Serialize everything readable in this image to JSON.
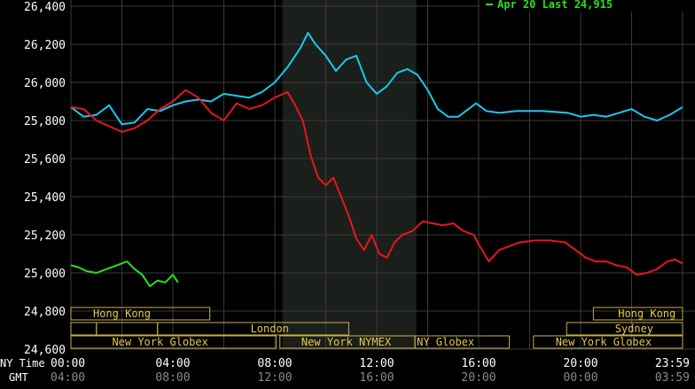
{
  "chart_data": {
    "type": "line",
    "legend_text": "Apr 20 Last 24,915",
    "legend_position": "top-right",
    "grid": true,
    "y_axis": {
      "min": 24600,
      "max": 26400,
      "ticks": [
        24600,
        24800,
        25000,
        25200,
        25400,
        25600,
        25800,
        26000,
        26200,
        26400
      ],
      "tick_labels": [
        "24,600",
        "24,800",
        "25,000",
        "25,200",
        "25,400",
        "25,600",
        "25,800",
        "26,000",
        "26,200",
        "26,400"
      ]
    },
    "x_axis": {
      "min": 0,
      "max": 24,
      "row_labels": [
        "NY Time",
        "GMT"
      ],
      "ny_ticks": [
        0,
        4,
        8,
        12,
        16,
        20,
        24
      ],
      "ny_labels": [
        "00:00",
        "04:00",
        "08:00",
        "12:00",
        "16:00",
        "20:00",
        "23:59"
      ],
      "gmt_labels": [
        "04:00",
        "08:00",
        "12:00",
        "16:00",
        "20:00",
        "00:00",
        "03:59"
      ]
    },
    "shaded_region": {
      "x_start": 8.3,
      "x_end": 13.55
    },
    "series": [
      {
        "color": "#19c8f0",
        "points": [
          [
            0,
            25870
          ],
          [
            0.5,
            25820
          ],
          [
            1,
            25830
          ],
          [
            1.5,
            25880
          ],
          [
            2,
            25780
          ],
          [
            2.5,
            25790
          ],
          [
            3,
            25860
          ],
          [
            3.5,
            25850
          ],
          [
            4,
            25880
          ],
          [
            4.5,
            25900
          ],
          [
            5,
            25910
          ],
          [
            5.5,
            25900
          ],
          [
            6,
            25940
          ],
          [
            6.5,
            25930
          ],
          [
            7,
            25920
          ],
          [
            7.5,
            25950
          ],
          [
            8,
            26000
          ],
          [
            8.5,
            26080
          ],
          [
            9,
            26180
          ],
          [
            9.3,
            26260
          ],
          [
            9.6,
            26200
          ],
          [
            10,
            26140
          ],
          [
            10.4,
            26060
          ],
          [
            10.8,
            26120
          ],
          [
            11.2,
            26140
          ],
          [
            11.6,
            26000
          ],
          [
            12,
            25940
          ],
          [
            12.4,
            25980
          ],
          [
            12.8,
            26050
          ],
          [
            13.2,
            26070
          ],
          [
            13.6,
            26040
          ],
          [
            14,
            25960
          ],
          [
            14.4,
            25860
          ],
          [
            14.8,
            25820
          ],
          [
            15.2,
            25820
          ],
          [
            15.6,
            25860
          ],
          [
            15.9,
            25890
          ],
          [
            16.3,
            25850
          ],
          [
            16.8,
            25840
          ],
          [
            17.5,
            25850
          ],
          [
            18.5,
            25850
          ],
          [
            19.5,
            25840
          ],
          [
            20,
            25820
          ],
          [
            20.5,
            25830
          ],
          [
            21,
            25820
          ],
          [
            21.5,
            25840
          ],
          [
            22,
            25860
          ],
          [
            22.5,
            25820
          ],
          [
            23,
            25800
          ],
          [
            23.5,
            25830
          ],
          [
            24,
            25870
          ]
        ]
      },
      {
        "color": "#e8161b",
        "points": [
          [
            0,
            25870
          ],
          [
            0.5,
            25860
          ],
          [
            1,
            25800
          ],
          [
            1.5,
            25770
          ],
          [
            2,
            25740
          ],
          [
            2.5,
            25760
          ],
          [
            3,
            25800
          ],
          [
            3.5,
            25860
          ],
          [
            4,
            25900
          ],
          [
            4.5,
            25960
          ],
          [
            5,
            25920
          ],
          [
            5.5,
            25840
          ],
          [
            6,
            25800
          ],
          [
            6.5,
            25890
          ],
          [
            7,
            25860
          ],
          [
            7.5,
            25880
          ],
          [
            8,
            25920
          ],
          [
            8.5,
            25950
          ],
          [
            8.8,
            25880
          ],
          [
            9.1,
            25800
          ],
          [
            9.4,
            25620
          ],
          [
            9.7,
            25500
          ],
          [
            10,
            25460
          ],
          [
            10.3,
            25500
          ],
          [
            10.6,
            25400
          ],
          [
            10.9,
            25300
          ],
          [
            11.2,
            25180
          ],
          [
            11.5,
            25120
          ],
          [
            11.8,
            25200
          ],
          [
            12.1,
            25100
          ],
          [
            12.4,
            25080
          ],
          [
            12.7,
            25160
          ],
          [
            13,
            25200
          ],
          [
            13.4,
            25220
          ],
          [
            13.8,
            25270
          ],
          [
            14.2,
            25260
          ],
          [
            14.6,
            25250
          ],
          [
            15,
            25260
          ],
          [
            15.4,
            25220
          ],
          [
            15.8,
            25200
          ],
          [
            16,
            25150
          ],
          [
            16.4,
            25060
          ],
          [
            16.8,
            25120
          ],
          [
            17.2,
            25140
          ],
          [
            17.6,
            25160
          ],
          [
            18.2,
            25170
          ],
          [
            18.8,
            25170
          ],
          [
            19.4,
            25160
          ],
          [
            19.8,
            25120
          ],
          [
            20.2,
            25080
          ],
          [
            20.6,
            25060
          ],
          [
            21,
            25060
          ],
          [
            21.4,
            25040
          ],
          [
            21.8,
            25030
          ],
          [
            22.2,
            24990
          ],
          [
            22.6,
            25000
          ],
          [
            23,
            25020
          ],
          [
            23.4,
            25060
          ],
          [
            23.7,
            25070
          ],
          [
            24,
            25050
          ]
        ]
      },
      {
        "color": "#2ae01f",
        "points": [
          [
            0,
            25040
          ],
          [
            0.3,
            25030
          ],
          [
            0.6,
            25010
          ],
          [
            1,
            25000
          ],
          [
            1.4,
            25020
          ],
          [
            1.8,
            25040
          ],
          [
            2.2,
            25060
          ],
          [
            2.5,
            25020
          ],
          [
            2.8,
            24990
          ],
          [
            3.1,
            24930
          ],
          [
            3.4,
            24960
          ],
          [
            3.7,
            24950
          ],
          [
            4.0,
            24990
          ],
          [
            4.2,
            24950
          ]
        ]
      }
    ],
    "session_rows": [
      [
        {
          "label": "Hong Kong",
          "start": 0,
          "end": 5.45,
          "label_at": 2.0
        },
        {
          "label": "Hong Kong",
          "start": 20.5,
          "end": 24,
          "label_at": 22.6
        }
      ],
      [
        {
          "label": "",
          "start": 0,
          "end": 1.0,
          "label_at": 0.5
        },
        {
          "label": "",
          "start": 1.0,
          "end": 3.4,
          "label_at": 2.2
        },
        {
          "label": "London",
          "start": 3.4,
          "end": 10.9,
          "label_at": 7.8
        },
        {
          "label": "Sydney",
          "start": 19.45,
          "end": 24,
          "label_at": 22.1
        }
      ],
      [
        {
          "label": "New York Globex",
          "start": 0,
          "end": 8.05,
          "label_at": 3.5
        },
        {
          "label": "New York NYMEX",
          "start": 8.2,
          "end": 13.5,
          "label_at": 10.8
        },
        {
          "label": "NY Globex",
          "start": 13.5,
          "end": 17.2,
          "label_at": 14.7
        },
        {
          "label": "New York Globex",
          "start": 18.15,
          "end": 24,
          "label_at": 20.9
        }
      ]
    ]
  }
}
